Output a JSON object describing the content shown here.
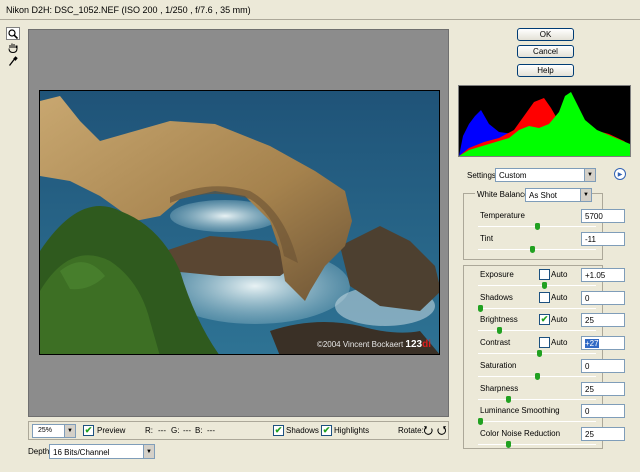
{
  "window": {
    "title": "Nikon D2H:  DSC_1052.NEF   (ISO 200 , 1/250 , f/7.6 , 35 mm)"
  },
  "tools": [
    {
      "name": "zoom-icon",
      "glyph": "🔍"
    },
    {
      "name": "hand-icon",
      "glyph": "✋"
    },
    {
      "name": "eyedropper-icon",
      "glyph": "✎"
    }
  ],
  "photo": {
    "watermark": "©2004 Vincent Bockaert",
    "logo_prefix": "123",
    "logo_suffix": "di"
  },
  "bottom": {
    "zoom_value": "25%",
    "preview_label": "Preview",
    "preview_checked": true,
    "r_label": "R:",
    "r_value": "---",
    "g_label": "G:",
    "g_value": "---",
    "b_label": "B:",
    "b_value": "---",
    "shadows_label": "Shadows",
    "shadows_checked": true,
    "highlights_label": "Highlights",
    "highlights_checked": true,
    "rotate_label": "Rotate:"
  },
  "depth": {
    "label": "Depth:",
    "value": "16 Bits/Channel"
  },
  "buttons": {
    "ok": "OK",
    "cancel": "Cancel",
    "help": "Help"
  },
  "settings": {
    "label": "Settings:",
    "value": "Custom"
  },
  "white_balance": {
    "label": "White Balance:",
    "value": "As Shot"
  },
  "sliders": {
    "temperature": {
      "label": "Temperature",
      "value": "5700",
      "level": 0.5
    },
    "tint": {
      "label": "Tint",
      "value": "-11",
      "level": 0.46
    },
    "exposure": {
      "label": "Exposure",
      "auto_label": "Auto",
      "auto_checked": false,
      "value": "+1.05",
      "level": 0.57
    },
    "shadows": {
      "label": "Shadows",
      "auto_label": "Auto",
      "auto_checked": false,
      "value": "0",
      "level": 0.0
    },
    "brightness": {
      "label": "Brightness",
      "auto_label": "Auto",
      "auto_checked": true,
      "value": "25",
      "level": 0.17
    },
    "contrast": {
      "label": "Contrast",
      "auto_label": "Auto",
      "auto_checked": false,
      "value": "+27",
      "level": 0.52
    },
    "saturation": {
      "label": "Saturation",
      "value": "0",
      "level": 0.5
    },
    "sharpness": {
      "label": "Sharpness",
      "value": "25",
      "level": 0.25
    },
    "luminance_smoothing": {
      "label": "Luminance Smoothing",
      "value": "0",
      "level": 0.0
    },
    "color_noise_reduction": {
      "label": "Color Noise Reduction",
      "value": "25",
      "level": 0.25
    }
  },
  "colors": {
    "slider_thumb": "#21a121",
    "selection": "#316ac5",
    "preview_bg": "#8c8c8c"
  }
}
